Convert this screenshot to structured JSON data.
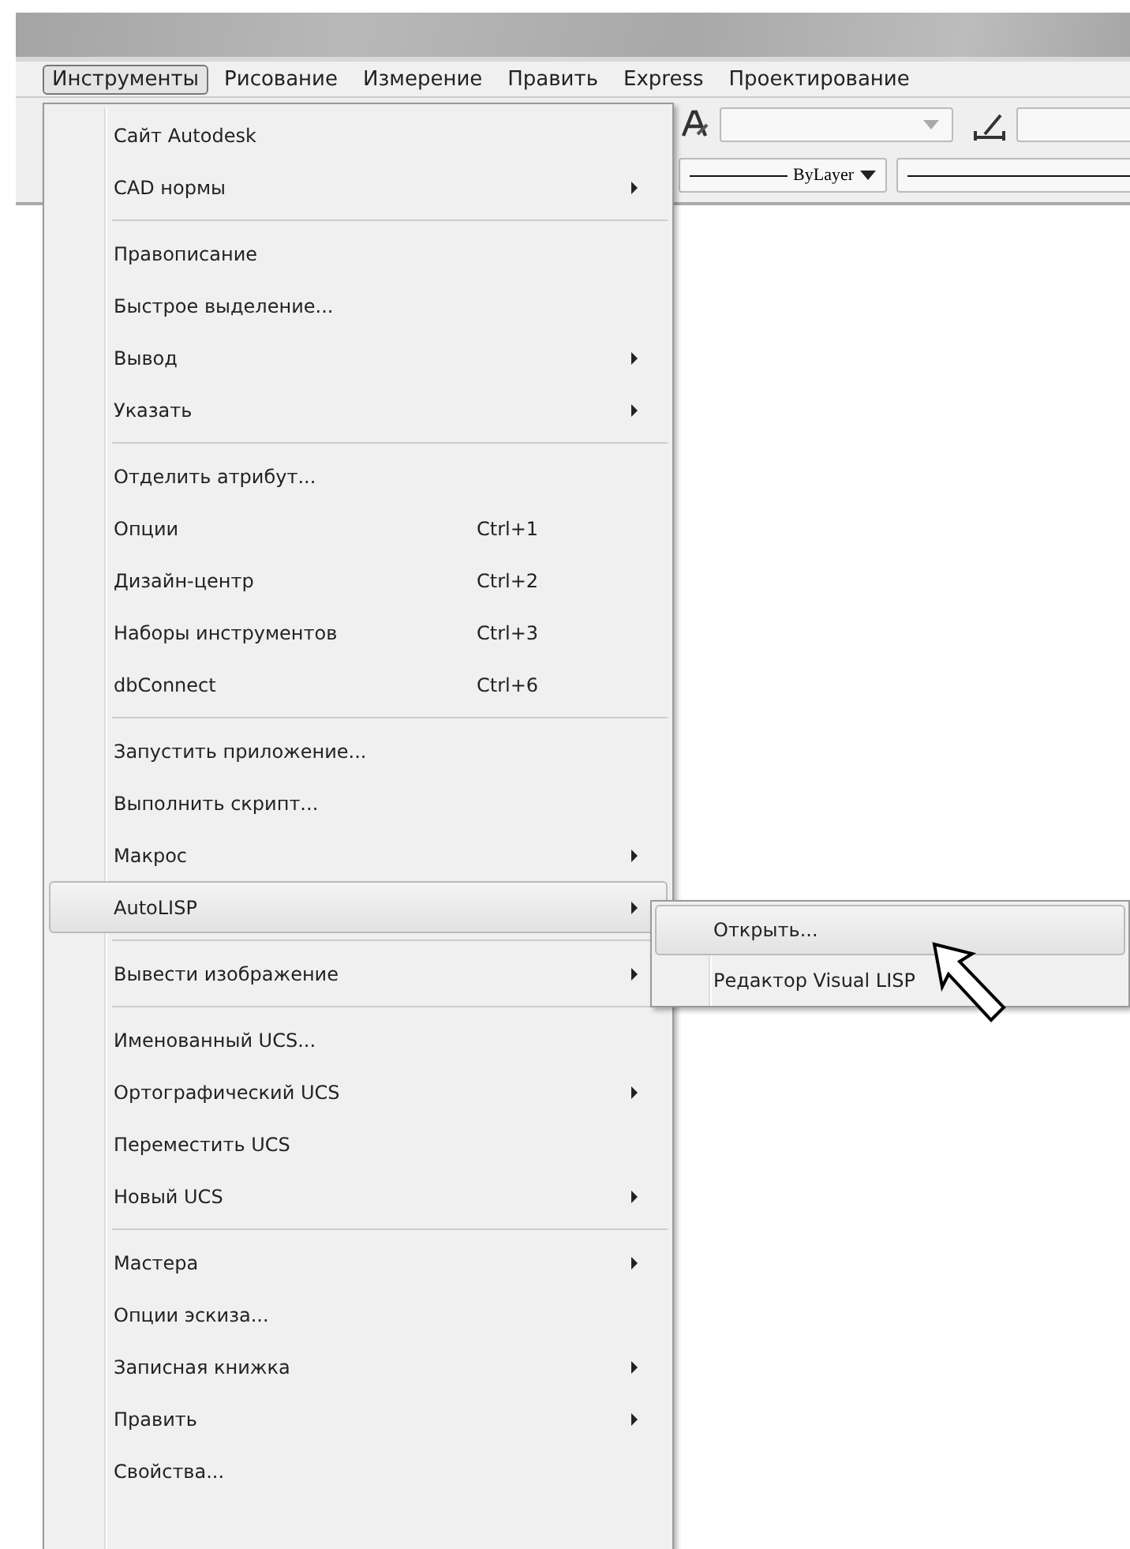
{
  "menubar": [
    {
      "label": "Инструменты",
      "selected": true
    },
    {
      "label": "Рисование",
      "selected": false
    },
    {
      "label": "Измерение",
      "selected": false
    },
    {
      "label": "Править",
      "selected": false
    },
    {
      "label": "Express",
      "selected": false
    },
    {
      "label": "Проектирование",
      "selected": false
    }
  ],
  "toolbar": {
    "linetype": "ByLayer"
  },
  "menu": [
    {
      "kind": "item",
      "label": "Сайт Autodesk",
      "has_submenu": false,
      "selected": false
    },
    {
      "kind": "item",
      "label": "CAD нормы",
      "has_submenu": true,
      "selected": false
    },
    {
      "kind": "separator"
    },
    {
      "kind": "item",
      "label": "Правописание",
      "has_submenu": false,
      "selected": false
    },
    {
      "kind": "item",
      "label": "Быстрое выделение...",
      "has_submenu": false,
      "selected": false
    },
    {
      "kind": "item",
      "label": "Вывод",
      "has_submenu": true,
      "selected": false
    },
    {
      "kind": "item",
      "label": "Указать",
      "has_submenu": true,
      "selected": false
    },
    {
      "kind": "separator"
    },
    {
      "kind": "item",
      "label": "Отделить атрибут...",
      "has_submenu": false,
      "selected": false
    },
    {
      "kind": "item",
      "label": "Опции",
      "shortcut": "Ctrl+1",
      "has_submenu": false,
      "selected": false
    },
    {
      "kind": "item",
      "label": "Дизайн-центр",
      "shortcut": "Ctrl+2",
      "has_submenu": false,
      "selected": false
    },
    {
      "kind": "item",
      "label": "Наборы инструментов",
      "shortcut": "Ctrl+3",
      "has_submenu": false,
      "selected": false
    },
    {
      "kind": "item",
      "label": "dbConnect",
      "shortcut": "Ctrl+6",
      "has_submenu": false,
      "selected": false
    },
    {
      "kind": "separator"
    },
    {
      "kind": "item",
      "label": "Запустить приложение...",
      "has_submenu": false,
      "selected": false
    },
    {
      "kind": "item",
      "label": "Выполнить скрипт...",
      "has_submenu": false,
      "selected": false
    },
    {
      "kind": "item",
      "label": "Макрос",
      "has_submenu": true,
      "selected": false
    },
    {
      "kind": "item",
      "label": "AutoLISP",
      "has_submenu": true,
      "selected": true
    },
    {
      "kind": "separator"
    },
    {
      "kind": "item",
      "label": "Вывести изображение",
      "has_submenu": true,
      "selected": false
    },
    {
      "kind": "separator"
    },
    {
      "kind": "item",
      "label": "Именованный UCS...",
      "has_submenu": false,
      "selected": false
    },
    {
      "kind": "item",
      "label": "Ортографический UCS",
      "has_submenu": true,
      "selected": false
    },
    {
      "kind": "item",
      "label": "Переместить UCS",
      "has_submenu": false,
      "selected": false
    },
    {
      "kind": "item",
      "label": "Новый UCS",
      "has_submenu": true,
      "selected": false
    },
    {
      "kind": "separator"
    },
    {
      "kind": "item",
      "label": "Мастера",
      "has_submenu": true,
      "selected": false
    },
    {
      "kind": "item",
      "label": "Опции эскиза...",
      "has_submenu": false,
      "selected": false
    },
    {
      "kind": "item",
      "label": "Записная книжка",
      "has_submenu": true,
      "selected": false
    },
    {
      "kind": "item",
      "label": "Править",
      "has_submenu": true,
      "selected": false
    },
    {
      "kind": "item",
      "label": "Свойства...",
      "has_submenu": false,
      "selected": false
    }
  ],
  "submenu": [
    {
      "label": "Открыть...",
      "selected": true
    },
    {
      "label": "Редактор Visual LISP",
      "selected": false
    }
  ]
}
